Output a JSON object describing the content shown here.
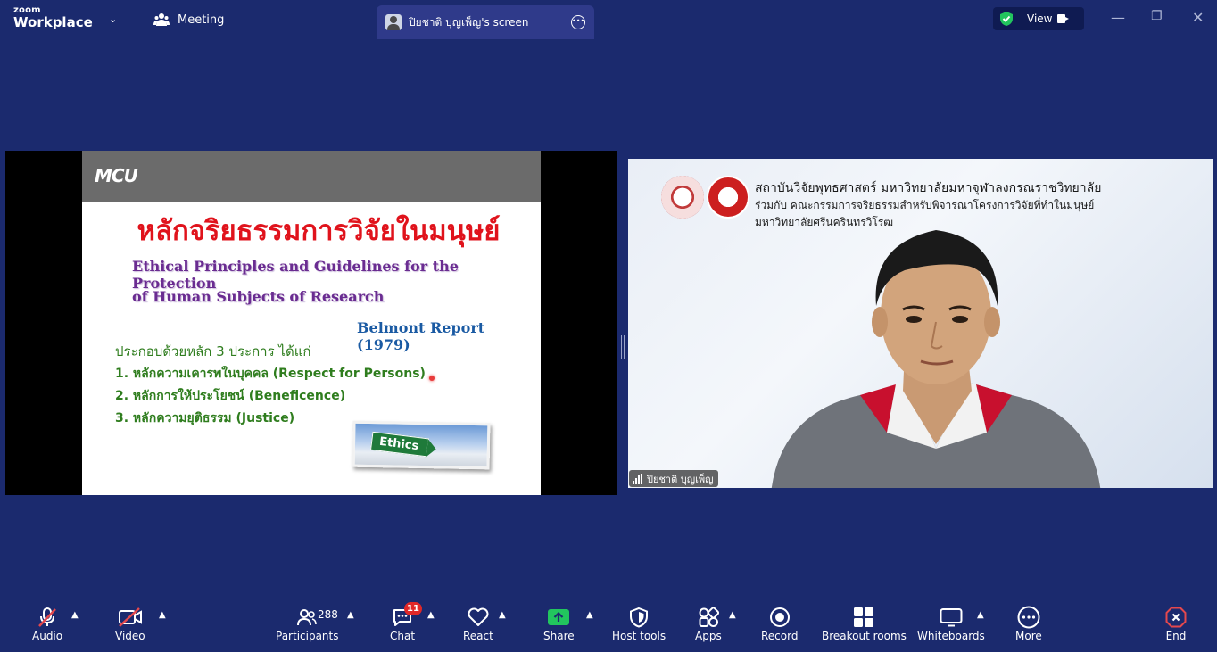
{
  "titlebar": {
    "logo_line1": "zoom",
    "logo_line2": "Workplace",
    "meeting_label": "Meeting",
    "screen_tab_label": "ปิยชาติ  บุญเพ็ญ's screen",
    "view_label": "View",
    "shield_color": "#22c55e"
  },
  "slide": {
    "logo_text": "MCU",
    "title_th": "หลักจริยธรรมการวิจัยในมนุษย์",
    "title_en_line1": "Ethical Principles and Guidelines for the Protection",
    "title_en_line2": "of Human Subjects of Research",
    "belmont": "Belmont Report (1979)",
    "intro": "ประกอบด้วยหลัก 3 ประการ ได้แก่",
    "items": [
      "1. หลักความเคารพในบุคคล (Respect for Persons)",
      "2. หลักการให้ประโยชน์ (Beneficence)",
      "3. หลักความยุติธรรม (Justice)"
    ],
    "ethics_sign": "Ethics"
  },
  "video": {
    "header_line1": "สถาบันวิจัยพุทธศาสตร์ มหาวิทยาลัยมหาจุฬาลงกรณราชวิทยาลัย",
    "header_line2": "ร่วมกับ คณะกรรมการจริยธรรมสำหรับพิจารณาโครงการวิจัยที่ทำในมนุษย์",
    "header_line3": "มหาวิทยาลัยศรีนครินทรวิโรฒ",
    "participant_name": "ปิยชาติ  บุญเพ็ญ"
  },
  "toolbar": {
    "audio": "Audio",
    "video": "Video",
    "participants": "Participants",
    "participants_count": "288",
    "chat": "Chat",
    "chat_badge": "11",
    "react": "React",
    "share": "Share",
    "host_tools": "Host tools",
    "apps": "Apps",
    "record": "Record",
    "breakout_rooms": "Breakout rooms",
    "whiteboards": "Whiteboards",
    "more": "More",
    "end": "End",
    "share_color": "#22c55e",
    "muted_color": "#e5484d"
  }
}
